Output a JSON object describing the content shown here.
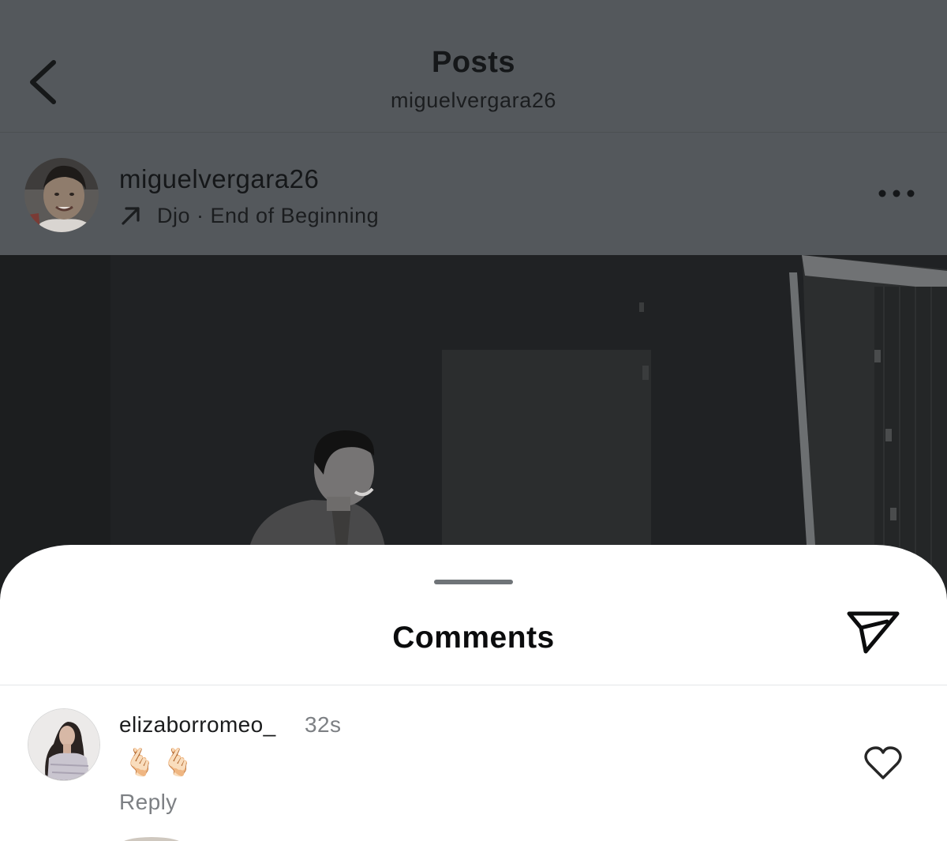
{
  "header": {
    "title": "Posts",
    "subtitle": "miguelvergara26",
    "back_icon": "chevron-left-icon"
  },
  "post": {
    "author": "miguelvergara26",
    "music_icon": "arrow-up-right-icon",
    "music": "Djo · End of Beginning",
    "more_icon": "more-horizontal-icon"
  },
  "comments_sheet": {
    "title": "Comments",
    "share_icon": "paper-plane-icon",
    "comments": [
      {
        "username": "elizaborromeo_",
        "time": "32s",
        "text": "🫰🏻🫰🏻",
        "reply_label": "Reply",
        "like_icon": "heart-icon"
      }
    ]
  },
  "colors": {
    "overlay_dim": "#54585c",
    "photo_bg": "#1f2123",
    "sheet_bg": "#ffffff",
    "secondary_text": "#7d8084"
  }
}
